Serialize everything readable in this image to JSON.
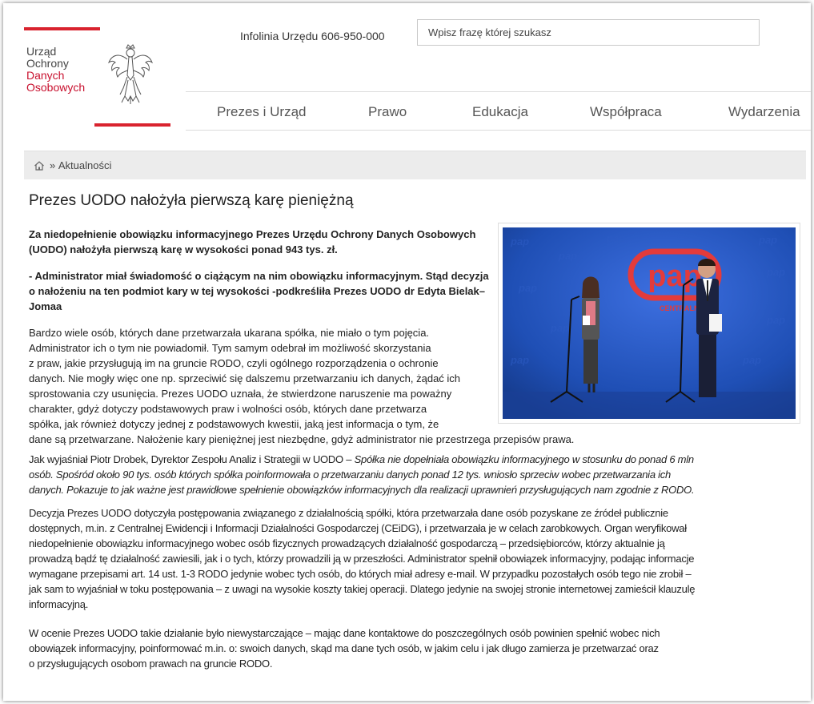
{
  "header": {
    "logo": {
      "line1": "Urząd",
      "line2": "Ochrony",
      "line3": "Danych",
      "line4": "Osobowych"
    },
    "hotline": "Infolinia Urzędu 606-950-000",
    "search_placeholder": "Wpisz frazę której szukasz"
  },
  "nav": {
    "items": [
      {
        "label": "Prezes i Urząd"
      },
      {
        "label": "Prawo"
      },
      {
        "label": "Edukacja"
      },
      {
        "label": "Współpraca"
      },
      {
        "label": "Wydarzenia"
      }
    ]
  },
  "breadcrumb": {
    "separator": "»",
    "current": "Aktualności"
  },
  "article": {
    "title": "Prezes UODO nałożyła pierwszą karę pieniężną",
    "lead1": "Za niedopełnienie obowiązku informacyjnego Prezes Urzędu Ochrony Danych Osobowych (UODO) nałożyła pierwszą karę w wysokości ponad 943 tys. zł.",
    "lead2": "- Administrator miał świadomość o ciążącym na nim obowiązku informacyjnym. Stąd decyzja o nałożeniu na ten podmiot kary w tej wysokości -podkreśliła Prezes UODO dr Edyta Bielak–Jomaa",
    "p1_lines": [
      "Bardzo wiele osób, których dane przetwarzała ukarana spółka, nie miało o tym pojęcia.",
      "Administrator ich o tym nie powiadomił. Tym samym odebrał im możliwość skorzystania",
      "z praw, jakie przysługują im na gruncie RODO, czyli ogólnego rozporządzenia o ochronie",
      "danych. Nie mogły więc one np. sprzeciwić się dalszemu przetwarzaniu ich danych, żądać ich",
      "sprostowania czy usunięcia. Prezes UODO uznała, że stwierdzone naruszenie ma poważny",
      "charakter, gdyż dotyczy podstawowych praw i wolności osób, których dane przetwarza",
      "spółka, jak również dotyczy jednej z podstawowych kwestii, jaką jest informacja o tym, że",
      "dane są przetwarzane. Nałożenie kary pieniężnej jest niezbędne, gdyż administrator nie przestrzega przepisów prawa."
    ],
    "p2_intro": "Jak wyjaśniał Piotr Drobek, Dyrektor Zespołu Analiz i Strategii w UODO – ",
    "p2_lines": [
      "Spółka nie dopełniała obowiązku informacyjnego w stosunku do ponad 6 mln",
      "osób.  Spośród około 90 tys. osób których spółka poinformowała o przetwarzaniu danych ponad 12 tys. wniosło sprzeciw wobec przetwarzania ich",
      "danych. Pokazuje to jak ważne jest prawidłowe spełnienie obowiązków informacyjnych dla realizacji uprawnień przysługujących nam zgodnie z RODO."
    ],
    "p3_lines": [
      "Decyzja Prezes UODO dotyczyła postępowania związanego z działalnością spółki, która przetwarzała dane osób pozyskane ze źródeł publicznie",
      "dostępnych, m.in. z Centralnej Ewidencji i Informacji Działalności Gospodarczej (CEiDG), i przetwarzała je w celach zarobkowych. Organ weryfikował",
      "niedopełnienie obowiązku informacyjnego wobec osób fizycznych prowadzących działalność gospodarczą – przedsiębiorców, którzy aktualnie ją",
      "prowadzą bądź tę działalność zawiesili, jak i o tych, którzy prowadzili ją w przeszłości. Administrator spełnił obowiązek informacyjny, podając informacje",
      "wymagane przepisami art. 14 ust. 1-3 RODO jedynie wobec tych osób, do których miał adresy e-mail. W przypadku pozostałych osób tego nie zrobił –",
      "jak sam to wyjaśniał w toku postępowania – z uwagi na wysokie koszty takiej operacji. Dlatego jedynie na swojej stronie internetowej zamieścił klauzulę",
      "informacyjną."
    ],
    "p4_lines": [
      "W ocenie Prezes UODO takie działanie było niewystarczające – mając dane kontaktowe do poszczególnych osób powinien spełnić wobec nich",
      "obowiązek informacyjny, poinformować m.in. o: swoich danych, skąd ma dane tych osób, w jakim celu i jak długo zamierza je przetwarzać oraz",
      "o przysługujących osobom prawach na gruncie RODO."
    ],
    "photo": {
      "sign_text": "pap",
      "sign_sub": "CENTRALNA"
    }
  },
  "colors": {
    "brand_red": "#d9232e",
    "backdrop_blue": "#1f4fb5"
  },
  "icons": {
    "home": "home-icon",
    "eagle": "eagle-emblem"
  }
}
